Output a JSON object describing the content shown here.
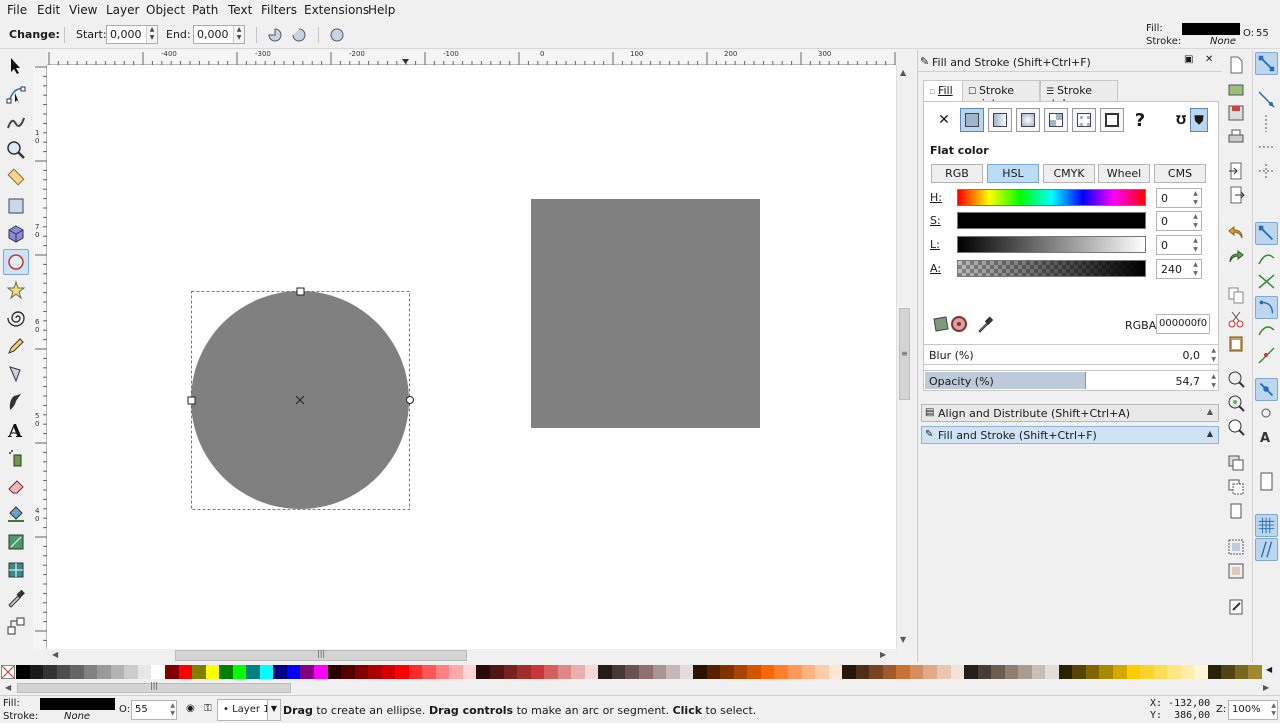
{
  "menu": [
    "File",
    "Edit",
    "View",
    "Layer",
    "Object",
    "Path",
    "Text",
    "Filters",
    "Extensions",
    "Help"
  ],
  "toolbar": {
    "change_label": "Change:",
    "start_label": "Start:",
    "start_value": "0,000",
    "end_label": "End:",
    "end_value": "0,000"
  },
  "style_indicator": {
    "fill_label": "Fill:",
    "stroke_label": "Stroke:",
    "stroke_value": "None",
    "opacity_label": "O:",
    "opacity_value": "55"
  },
  "ruler": {
    "top_labels": [
      "-400",
      "-300",
      "-200",
      "-100",
      "0",
      "100",
      "200",
      "300"
    ],
    "left_labels": [
      "1",
      "0",
      "7",
      "0",
      "6",
      "0",
      "5",
      "0",
      "4",
      "0"
    ]
  },
  "canvas": {
    "circle_color": "#808080",
    "rect_color": "#808080"
  },
  "dock": {
    "title": "Fill and Stroke (Shift+Ctrl+F)",
    "tabs": [
      "Fill",
      "Stroke paint",
      "Stroke style"
    ],
    "paint_type_heading": "Flat color",
    "modes": [
      "RGB",
      "HSL",
      "CMYK",
      "Wheel",
      "CMS"
    ],
    "sliders": [
      {
        "label": "H:",
        "value": "0"
      },
      {
        "label": "S:",
        "value": "0"
      },
      {
        "label": "L:",
        "value": "0"
      },
      {
        "label": "A:",
        "value": "240"
      }
    ],
    "rgba_label": "RGBA:",
    "rgba_value": "000000f0",
    "blur_label": "Blur (%)",
    "blur_value": "0,0",
    "opacity_label": "Opacity (%)",
    "opacity_value": "54,7",
    "opacity_fraction": 0.547,
    "collapsed_panels": [
      "Align and Distribute (Shift+Ctrl+A)",
      "Fill and Stroke (Shift+Ctrl+F)"
    ]
  },
  "status": {
    "fill_label": "Fill:",
    "stroke_label": "Stroke:",
    "stroke_value": "None",
    "opacity_label": "O:",
    "opacity_value": "55",
    "layer_name": "Layer 1",
    "message_bold_1": "Drag",
    "message_1": " to create an ellipse. ",
    "message_bold_2": "Drag controls",
    "message_2": " to make an arc or segment. ",
    "message_bold_3": "Click",
    "message_3": " to select.",
    "x_coord": "X: -132,00",
    "y_coord": "Y:  386,00",
    "zoom_label": "Z:",
    "zoom_value": "100%"
  },
  "palette_colors": [
    "#000000",
    "#1a1a1a",
    "#333333",
    "#4d4d4d",
    "#666666",
    "#808080",
    "#999999",
    "#b3b3b3",
    "#cccccc",
    "#e6e6e6",
    "#ffffff",
    "#800000",
    "#ff0000",
    "#808000",
    "#ffff00",
    "#008000",
    "#00ff00",
    "#008080",
    "#00ffff",
    "#000080",
    "#0000ff",
    "#800080",
    "#ff00ff",
    "#2b0000",
    "#550000",
    "#800000",
    "#aa0000",
    "#d40000",
    "#ff0000",
    "#ff2a2a",
    "#ff5555",
    "#ff8080",
    "#ffaaaa",
    "#ffd5d5",
    "#280b0b",
    "#501616",
    "#782121",
    "#a02c2c",
    "#c83737",
    "#d35f5f",
    "#de8787",
    "#e9afaf",
    "#f4d7d7",
    "#241c1c",
    "#483737",
    "#6c5353",
    "#916f6f",
    "#ac9393",
    "#c8b7b7",
    "#e3dbdb",
    "#2b1100",
    "#552200",
    "#803300",
    "#aa4400",
    "#d45500",
    "#ff6600",
    "#ff7f2a",
    "#ff9955",
    "#ffb380",
    "#ffccaa",
    "#ffe6d5",
    "#28170b",
    "#502d16",
    "#784421",
    "#a05a2c",
    "#c87137",
    "#d38d5f",
    "#deaa87",
    "#e9c6af",
    "#f4e3d7",
    "#241f1c",
    "#483e37",
    "#6c5d53",
    "#917c6f",
    "#ac9d93",
    "#c8beb7",
    "#e3dedb",
    "#2b2200",
    "#554400",
    "#806600",
    "#aa8800",
    "#d4aa00",
    "#ffcc00",
    "#ffd42a",
    "#ffdd55",
    "#ffe680",
    "#ffeeaa",
    "#fff6d5",
    "#28220b",
    "#504416",
    "#786721",
    "#a0892c"
  ]
}
